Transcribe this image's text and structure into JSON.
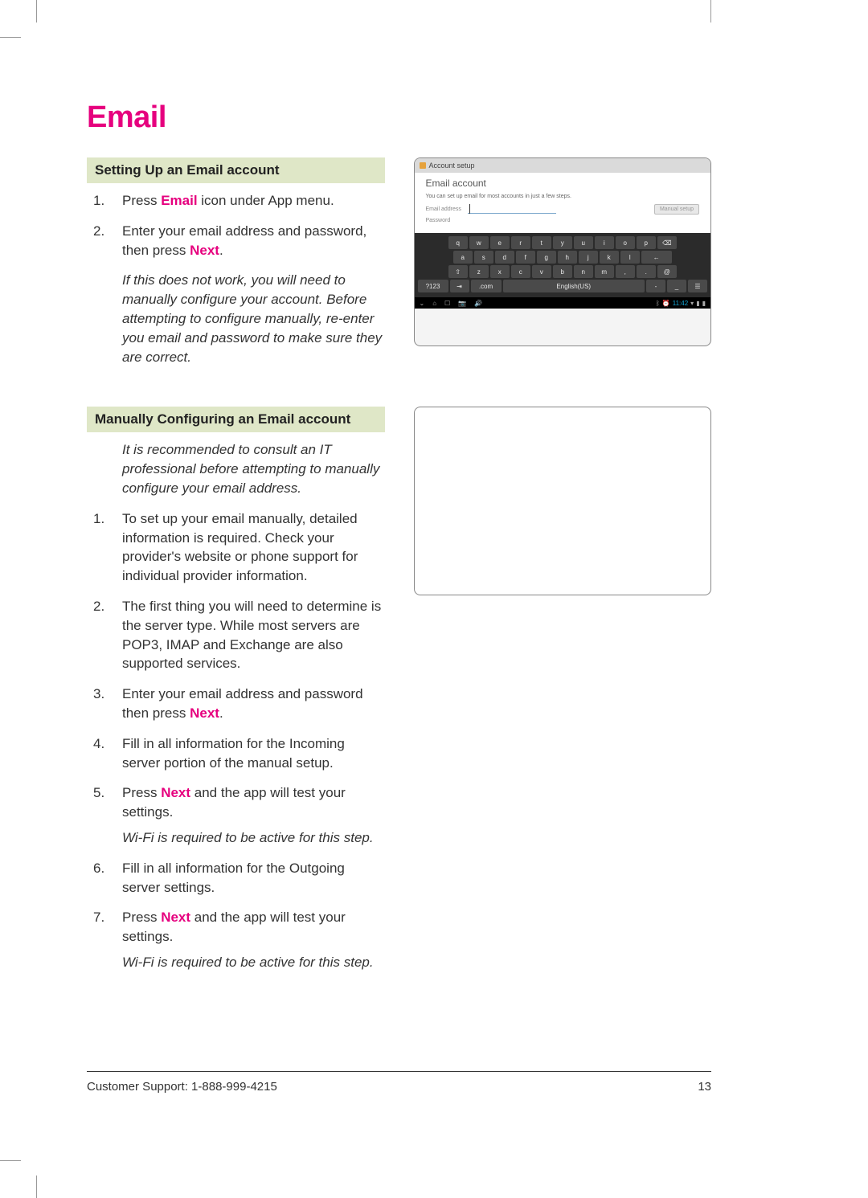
{
  "page": {
    "title": "Email",
    "page_number": "13",
    "footer_support": "Customer Support: 1-888-999-4215"
  },
  "section1": {
    "heading": "Setting Up an Email account",
    "steps": [
      {
        "pre": "Press ",
        "bold": "Email",
        "post": " icon under App menu."
      },
      {
        "pre": "Enter your email address and password, then press ",
        "bold": "Next",
        "post": "."
      }
    ],
    "note": "If this does not work, you will need to manually configure your account. Before attempting to configure manually, re-enter you email and password to make sure they are correct."
  },
  "section2": {
    "heading": "Manually Configuring an Email account",
    "intro_note": "It is recommended to consult an IT professional before attempting to manually configure your email address.",
    "steps": [
      {
        "pre": "To set up your email manually, detailed information is required. Check your provider's website or phone support for individual provider information.",
        "bold": "",
        "post": ""
      },
      {
        "pre": "The first thing you will need to determine is the server type. While most servers are POP3, IMAP and Exchange are also supported services.",
        "bold": "",
        "post": ""
      },
      {
        "pre": "Enter your email address and password then press ",
        "bold": "Next",
        "post": "."
      },
      {
        "pre": "Fill in all information for the Incoming server portion of the manual setup.",
        "bold": "",
        "post": ""
      },
      {
        "pre": "Press ",
        "bold": "Next",
        "post": " and the app will test your settings."
      },
      {
        "pre": "Fill in all information for the Outgoing server settings.",
        "bold": "",
        "post": ""
      },
      {
        "pre": "Press ",
        "bold": "Next",
        "post": " and the app will test your settings."
      }
    ],
    "wifi_note": "Wi-Fi is required to be active for this step."
  },
  "screenshot": {
    "window_title": "Account setup",
    "heading": "Email account",
    "sub": "You can set up email for most accounts in just a few steps.",
    "field_email": "Email address",
    "field_password": "Password",
    "button": "Manual setup",
    "keyboard": {
      "row1": [
        "q",
        "w",
        "e",
        "r",
        "t",
        "y",
        "u",
        "i",
        "o",
        "p",
        "⌫"
      ],
      "row2": [
        "a",
        "s",
        "d",
        "f",
        "g",
        "h",
        "j",
        "k",
        "l",
        "←"
      ],
      "row3": [
        "⇧",
        "z",
        "x",
        "c",
        "v",
        "b",
        "n",
        "m",
        ",",
        ".",
        "@"
      ],
      "row4_left": "?123",
      "row4_tab": "⇥",
      "row4_com": ".com",
      "row4_space": "English(US)",
      "row4_dash": "-",
      "row4_under": "_",
      "row4_menu": "☰"
    },
    "navbar_time": "11:42"
  }
}
